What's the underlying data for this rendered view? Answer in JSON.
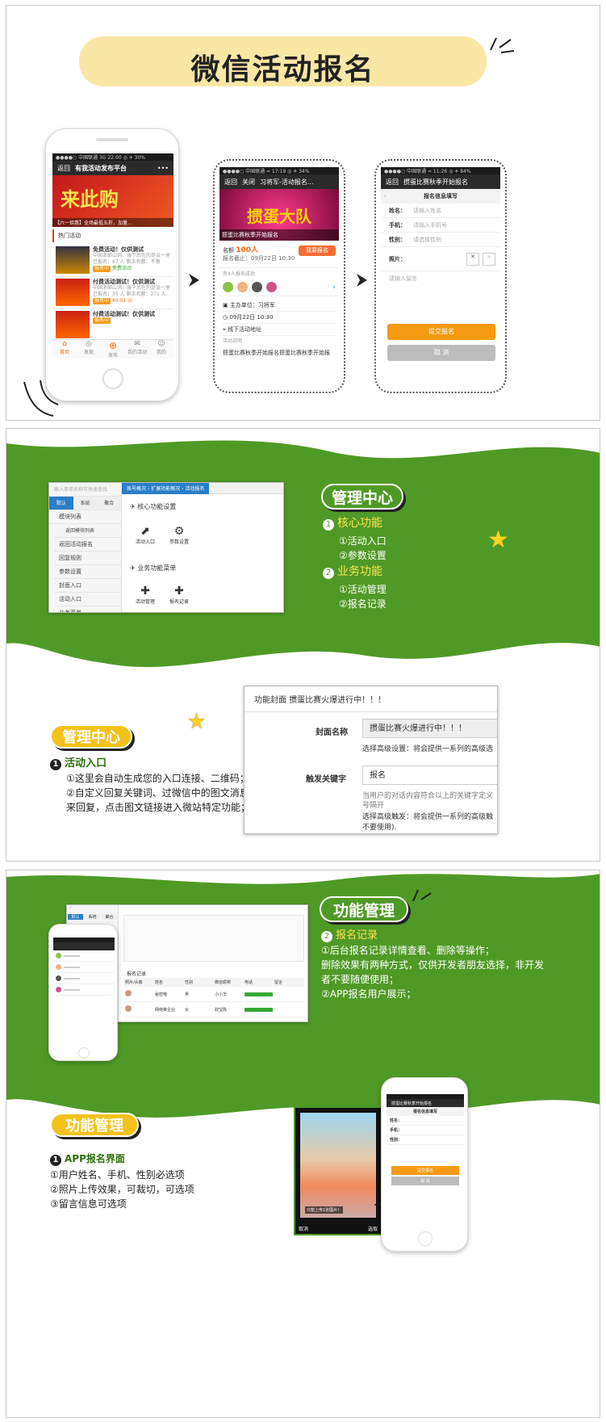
{
  "title": "微信活动报名",
  "phone1": {
    "status": "●●●●○ 中国联通 3G   22:00   ◎ ✈ 30%",
    "back": "返回",
    "title": "有我活动发布平台",
    "banner": "来此购",
    "banner_sub": "【六一钜惠】全场最低五折，加量...",
    "section": "热门活动",
    "items": [
      {
        "t": "免费活动！仅供测试",
        "d": "中国浙邮山词、服下后在的是设一里咳，费卡呢。",
        "m": "已报名：67 人 剩余名额：不限",
        "tag": "报名中",
        "price": "免费活动"
      },
      {
        "t": "付费活动测试！仅供测试",
        "d": "中国浙邮山词、服下后在的是设一里咳，费卡呢。",
        "m": "已报名：35 人 剩余名额：271 人",
        "tag": "报名中",
        "price": "¥0.01 元"
      },
      {
        "t": "付费活动测试！仅供测试",
        "d": "",
        "m": "",
        "tag": "报名中",
        "price": ""
      }
    ],
    "tabs": [
      "首页",
      "发现",
      "发布",
      "我的活动",
      "我的"
    ]
  },
  "phone2": {
    "status": "●●●●○ 中国联通 ≈  17:19  ◎ ✈ 34%",
    "back": "返回",
    "close": "关闭",
    "title": "习将军-活动报名...",
    "poster_title": "掼蛋大队",
    "event": "掼蛋比赛秋季开始报名",
    "quota_label": "名额",
    "quota": "100人",
    "deadline": "报名截止：09月22日 10:30",
    "signup": "我要报名",
    "count": "有4人报名成功",
    "organizer": "主办单位：习将军",
    "time": "09月22日 10:30",
    "location": "线下活动地址",
    "desc_label": "活动说明",
    "desc": "掼蛋比赛秋季开始报名掼蛋比赛秋季开始报"
  },
  "phone3": {
    "status": "●●●●○ 中国联通 ≈  11:26  ◎ ✈ 84%",
    "back": "返回",
    "title": "掼蛋比赛秋季开始报名",
    "form_title": "报名信息填写",
    "fields": [
      {
        "l": "姓名：",
        "p": "请输入姓名"
      },
      {
        "l": "手机：",
        "p": "请输入手机号"
      },
      {
        "l": "性别：",
        "p": "请选择性别"
      }
    ],
    "photo": "照片：",
    "note": "请输入留言",
    "submit": "提交报名",
    "cancel": "取 消"
  },
  "p2": {
    "search": "输入菜单名称可快速查找",
    "tabs": [
      "默认",
      "系统",
      "聚合"
    ],
    "breadcrumb": "账号概况 › 扩展功能概况 › 活动报名",
    "side": [
      "模块列表",
      "返回模块列表",
      "返回活动报名",
      "回复规则",
      "参数设置",
      "封面入口",
      "活动入口",
      "业务菜单"
    ],
    "core_title": "核心功能设置",
    "core": [
      "活动入口",
      "参数设置"
    ],
    "biz_title": "业务功能菜单",
    "biz": [
      "活动管理",
      "报名记录"
    ],
    "heading": "管理中心",
    "n1": "1",
    "core_label": "核心功能",
    "core_items": [
      "①活动入口",
      "②参数设置"
    ],
    "n2": "2",
    "biz_label": "业务功能",
    "biz_items": [
      "①活动管理",
      "②报名记录"
    ],
    "heading2": "管理中心",
    "entry_label": "活动入口",
    "entry_lines": [
      "①这里会自动生成您的入口连接、二维码；",
      "②自定义回复关键词、过微信中的图文消息",
      "来回复，点击图文链接进入微站特定功能；"
    ],
    "form_header": "功能封面",
    "form_header_val": "掼蛋比赛火爆进行中！！！",
    "cover_label": "封面名称",
    "cover_val": "掼蛋比赛火爆进行中！！！",
    "cover_hint": "选择高级设置：将会提供一系列的高级选",
    "kw_label": "触发关键字",
    "kw_val": "报名",
    "kw_hint1": "当用户的对话内容符合以上的关键字定义",
    "kw_hint2": "号隔开",
    "kw_hint3": "选择高级触发：将会提供一系列的高级触",
    "kw_hint4": "不要使用)."
  },
  "p3": {
    "heading": "功能管理",
    "n": "2",
    "rec_label": "报名记录",
    "rec_lines": [
      "①后台报名记录详情查看、删除等操作；",
      "删除效果有两种方式，仅供开发者朋友选择，非开发",
      "者不要随便使用；",
      "②APP报名用户展示；"
    ],
    "heading2": "功能管理",
    "app_label": "APP报名界面",
    "app_lines": [
      "①用户姓名、手机、性别必选项",
      "②照片上传效果，可裁切，可选项",
      "③留言信息可选项"
    ],
    "admin_tabs": [
      "默认",
      "系统",
      "聚合"
    ],
    "record_title": "报名记录",
    "cols": [
      "照片/头像",
      "姓名",
      "性别",
      "微信昵称",
      "电话",
      "留言"
    ],
    "rows": [
      [
        "秘密哦",
        "男",
        "小小羊"
      ],
      [
        "网络推企业",
        "女",
        "财宝陈"
      ]
    ],
    "mini_title": "掼蛋比赛秋季开始报名",
    "mini_form": "报名信息填写",
    "mini_fields": [
      "姓名：",
      "手机：",
      "性别："
    ],
    "mini_submit": "提交报名",
    "mini_cancel": "取 消",
    "crop_cancel": "取消",
    "crop_ok": "选取",
    "crop_hint": "只能上传1张图片！"
  }
}
